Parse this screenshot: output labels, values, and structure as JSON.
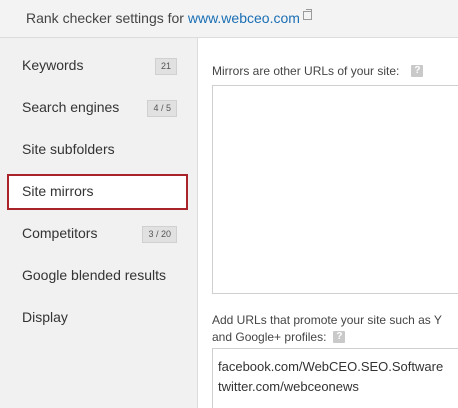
{
  "header": {
    "title_prefix": "Rank checker settings for",
    "site_link": "www.webceo.com",
    "ext_icon": "external-link-icon"
  },
  "sidebar": {
    "items": [
      {
        "label": "Keywords",
        "badge": "21"
      },
      {
        "label": "Search engines",
        "badge": "4 / 5"
      },
      {
        "label": "Site subfolders",
        "badge": ""
      },
      {
        "label": "Site mirrors",
        "badge": "",
        "selected": true
      },
      {
        "label": "Competitors",
        "badge": "3 / 20"
      },
      {
        "label": "Google blended results",
        "badge": ""
      },
      {
        "label": "Display",
        "badge": ""
      }
    ],
    "selected_color": "#a8232a"
  },
  "main": {
    "mirrors_label": "Mirrors are other URLs of your site:",
    "mirrors_value": "",
    "promote_label_line1": "Add URLs that promote your site such as Y",
    "promote_label_line2": "and Google+ profiles:",
    "promote_lines": [
      "facebook.com/WebCEO.SEO.Software",
      "twitter.com/webceonews"
    ],
    "help_icon": "?"
  },
  "colors": {
    "link": "#1a6fb4",
    "sidebar_bg": "#f1f1f1",
    "header_bg": "#f3f3f3"
  }
}
